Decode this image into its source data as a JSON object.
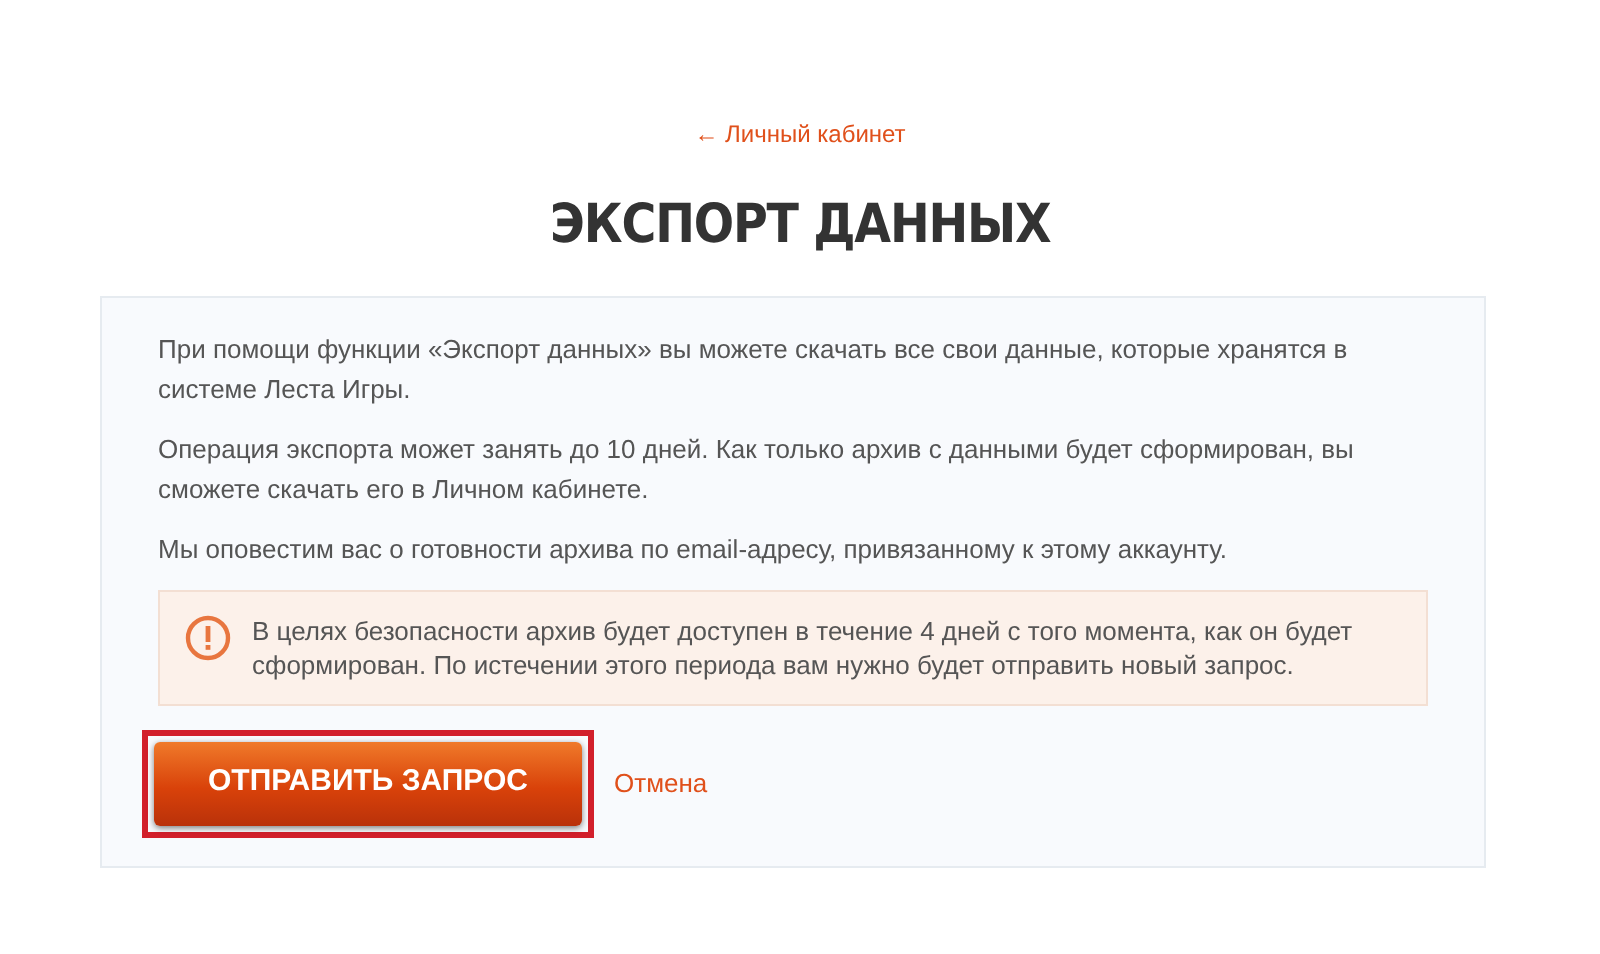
{
  "back_link": "← Личный кабинет",
  "title": "ЭКСПОРТ ДАННЫХ",
  "paragraphs": [
    "При помощи функции «Экспорт данных» вы можете скачать все свои данные, которые хранятся в системе Леста Игры.",
    "Операция экспорта может занять до 10 дней. Как только архив с данными будет сформирован, вы сможете скачать его в Личном кабинете.",
    "Мы оповестим вас о готовности архива по email-адресу, привязанному к этому аккаунту."
  ],
  "notice": {
    "text": "В целях безопасности архив будет доступен в течение 4 дней с того момента, как он будет сформирован. По истечении этого периода вам нужно будет отправить новый запрос."
  },
  "submit_button": {
    "label": "ОТПРАВИТЬ ЗАПРОС",
    "highlighted": true
  },
  "cancel_link": "Отмена"
}
